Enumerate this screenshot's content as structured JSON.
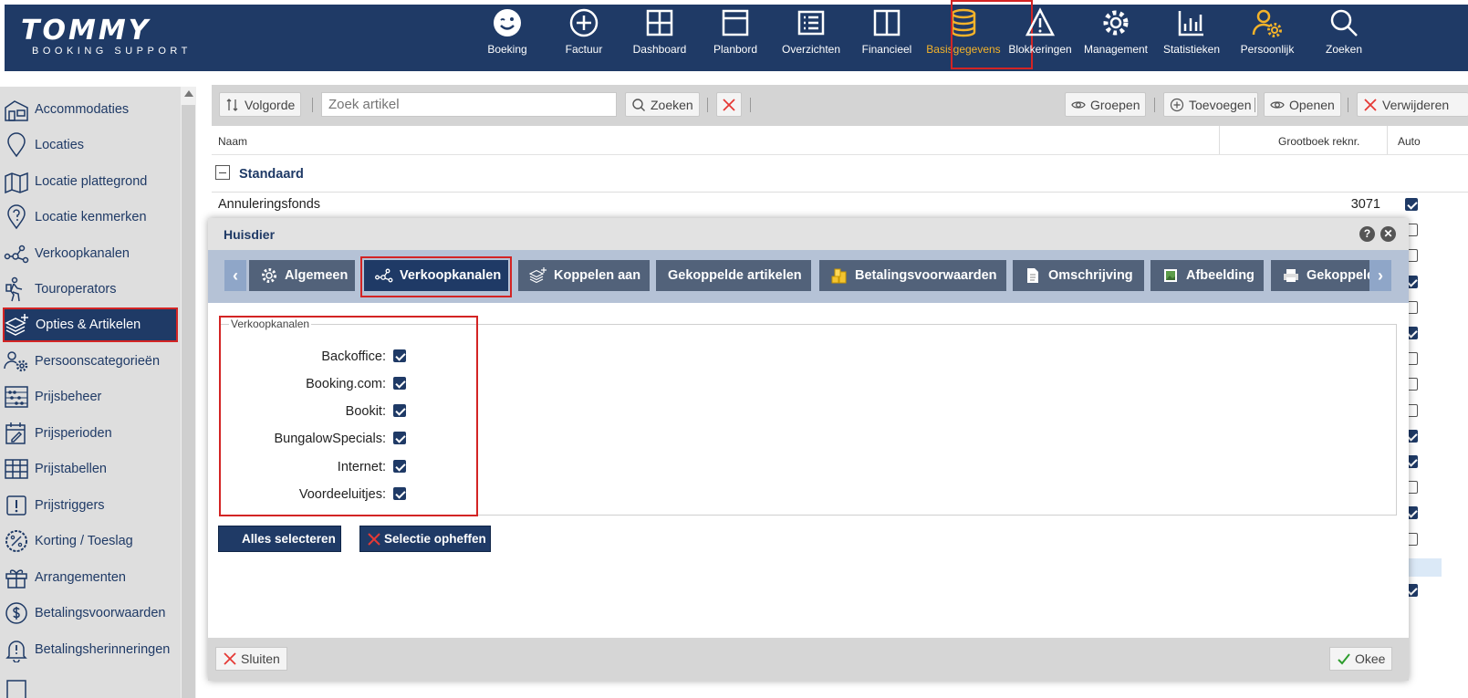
{
  "logo": {
    "main": "TOMMY",
    "sub": "BOOKING SUPPORT"
  },
  "nav": [
    {
      "label": "Boeking",
      "icon": "smiley-icon"
    },
    {
      "label": "Factuur",
      "icon": "plus-circle-icon"
    },
    {
      "label": "Dashboard",
      "icon": "grid-icon"
    },
    {
      "label": "Planbord",
      "icon": "board-icon"
    },
    {
      "label": "Overzichten",
      "icon": "list-icon"
    },
    {
      "label": "Financieel",
      "icon": "columns-icon"
    },
    {
      "label": "Basisgegevens",
      "icon": "database-icon",
      "active": true
    },
    {
      "label": "Blokkeringen",
      "icon": "warning-icon"
    },
    {
      "label": "Management",
      "icon": "gear-icon"
    },
    {
      "label": "Statistieken",
      "icon": "bar-chart-icon"
    },
    {
      "label": "Persoonlijk",
      "icon": "user-gear-icon"
    },
    {
      "label": "Zoeken",
      "icon": "search-icon"
    }
  ],
  "sidebar": {
    "items": [
      {
        "label": "Accommodaties",
        "icon": "building-icon"
      },
      {
        "label": "Locaties",
        "icon": "location-pin-icon"
      },
      {
        "label": "Locatie plattegrond",
        "icon": "map-icon"
      },
      {
        "label": "Locatie kenmerken",
        "icon": "location-question-icon"
      },
      {
        "label": "Verkoopkanalen",
        "icon": "share-nodes-icon"
      },
      {
        "label": "Touroperators",
        "icon": "traveler-icon"
      },
      {
        "label": "Opties & Artikelen",
        "icon": "layers-plus-icon",
        "active": true
      },
      {
        "label": "Persoonscategorieën",
        "icon": "people-gear-icon"
      },
      {
        "label": "Prijsbeheer",
        "icon": "abacus-icon"
      },
      {
        "label": "Prijsperioden",
        "icon": "calendar-edit-icon"
      },
      {
        "label": "Prijstabellen",
        "icon": "table-icon"
      },
      {
        "label": "Prijstriggers",
        "icon": "exclamation-box-icon"
      },
      {
        "label": "Korting / Toeslag",
        "icon": "percent-badge-icon"
      },
      {
        "label": "Arrangementen",
        "icon": "gift-icon"
      },
      {
        "label": "Betalingsvoorwaarden",
        "icon": "dollar-circle-icon"
      },
      {
        "label": "Betalingsherinneringen",
        "icon": "bell-alert-icon"
      }
    ]
  },
  "toolbar": {
    "sort_label": "Volgorde",
    "search_placeholder": "Zoek artikel",
    "search_label": "Zoeken",
    "groups_label": "Groepen",
    "add_label": "Toevoegen",
    "open_label": "Openen",
    "delete_label": "Verwijderen"
  },
  "list": {
    "columns": {
      "name": "Naam",
      "ledger": "Grootboek reknr.",
      "auto": "Auto"
    },
    "group": "Standaard",
    "rows": [
      {
        "name": "Annuleringsfonds",
        "ledger": "3071",
        "auto": true
      }
    ],
    "auto_checks": [
      true,
      false,
      false,
      true,
      false,
      true,
      false,
      false,
      false,
      true,
      true,
      false,
      true,
      false,
      false,
      true
    ]
  },
  "dialog": {
    "title": "Huisdier",
    "help": "?",
    "close": "✕",
    "tabs": [
      {
        "label": "Algemeen",
        "icon": "gear-icon"
      },
      {
        "label": "Verkoopkanalen",
        "icon": "share-nodes-icon",
        "active": true
      },
      {
        "label": "Koppelen aan",
        "icon": "layers-plus-icon"
      },
      {
        "label": "Gekoppelde artikelen",
        "icon": ""
      },
      {
        "label": "Betalingsvoorwaarden",
        "icon": "coins-icon"
      },
      {
        "label": "Omschrijving",
        "icon": "document-icon"
      },
      {
        "label": "Afbeelding",
        "icon": "image-icon"
      },
      {
        "label": "Gekoppelde",
        "icon": "printer-icon"
      }
    ],
    "fieldset_title": "Verkoopkanalen",
    "channels": [
      {
        "label": "Backoffice:",
        "checked": true
      },
      {
        "label": "Booking.com:",
        "checked": true
      },
      {
        "label": "Bookit:",
        "checked": true
      },
      {
        "label": "BungalowSpecials:",
        "checked": true
      },
      {
        "label": "Internet:",
        "checked": true
      },
      {
        "label": "Voordeeluitjes:",
        "checked": true
      }
    ],
    "select_all": "Alles selecteren",
    "deselect": "Selectie opheffen",
    "close_label": "Sluiten",
    "ok_label": "Okee"
  },
  "colors": {
    "navy": "#1f3a66",
    "accent": "#f4b32a",
    "highlight": "#d32424"
  }
}
